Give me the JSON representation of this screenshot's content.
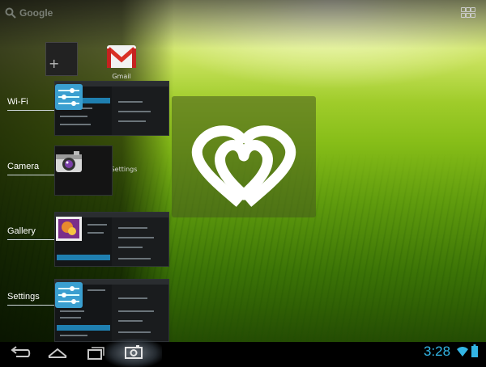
{
  "home": {
    "search_label": "Google",
    "gmail_label": "Gmail",
    "settings_widget_label": "Settings"
  },
  "recent_tasks": [
    {
      "label": "Wi-Fi"
    },
    {
      "label": "Camera"
    },
    {
      "label": "Gallery"
    },
    {
      "label": "Settings"
    }
  ],
  "status_bar": {
    "time": "3:28"
  },
  "colors": {
    "clock": "#33b5e5",
    "highlight": "#1f7fb0"
  }
}
